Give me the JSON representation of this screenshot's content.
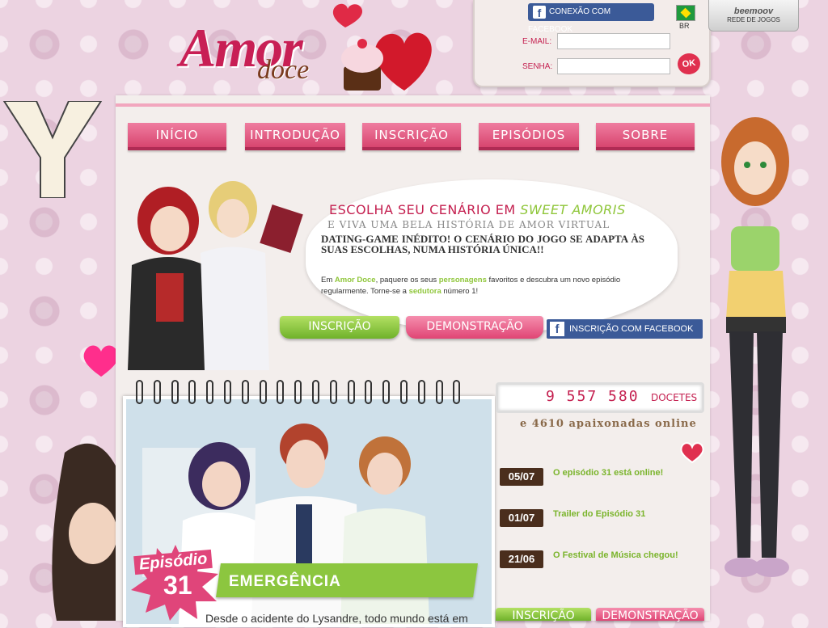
{
  "logo": {
    "word1": "Amor",
    "word2": "doce"
  },
  "login": {
    "facebook_label": "CONEXÃO COM FACEBOOK",
    "country": "BR",
    "email_label": "E-MAIL:",
    "password_label": "SENHA:",
    "ok_label": "OK"
  },
  "network": {
    "brand": "beemoov",
    "label": "REDE DE JOGOS"
  },
  "nav": [
    {
      "label": "INÍCIO"
    },
    {
      "label": "INTRODUÇÃO"
    },
    {
      "label": "INSCRIÇÃO"
    },
    {
      "label": "EPISÓDIOS"
    },
    {
      "label": "SOBRE"
    }
  ],
  "hero": {
    "title_prefix": "ESCOLHA SEU CENÁRIO EM ",
    "title_highlight": "SWEET AMORIS",
    "subtitle": "E VIVA UMA BELA HISTÓRIA DE AMOR VIRTUAL",
    "tagline": "DATING-GAME INÉDITO! O CENÁRIO DO JOGO SE ADAPTA ÀS SUAS ESCOLHAS, NUMA HISTÓRIA ÚNICA!!",
    "body_1": "Em ",
    "body_game": "Amor Doce",
    "body_2": ", paquere os seus ",
    "body_chars": "personagens",
    "body_3": " favoritos e descubra um novo episódio regularmente. Torne-se a ",
    "body_seductress": "sedutora",
    "body_4": " número 1!",
    "signup_label": "INSCRIÇÃO",
    "demo_label": "DEMONSTRAÇÃO",
    "fb_signup_label": "INSCRIÇÃO COM FACEBOOK"
  },
  "episode": {
    "word": "Episódio",
    "number": "31",
    "title": "EMERGÊNCIA",
    "teaser": "Desde o acidente do Lysandre, todo mundo está em"
  },
  "stats": {
    "count": "9 557 580",
    "unit": "DOCETES",
    "online": "e 4610 apaixonadas online"
  },
  "news": [
    {
      "date": "05/07",
      "text": "O episódio 31 está online!"
    },
    {
      "date": "01/07",
      "text": "Trailer do Episódio 31"
    },
    {
      "date": "21/06",
      "text": "O Festival de Música chegou!"
    }
  ],
  "bottom": {
    "signup_label": "INSCRIÇÃO",
    "demo_label": "DEMONSTRAÇÃO"
  },
  "colors": {
    "brand_pink": "#c41f4f",
    "accent_green": "#8cc63f",
    "facebook_blue": "#3b5a98",
    "date_brown": "#4a2e1d"
  }
}
